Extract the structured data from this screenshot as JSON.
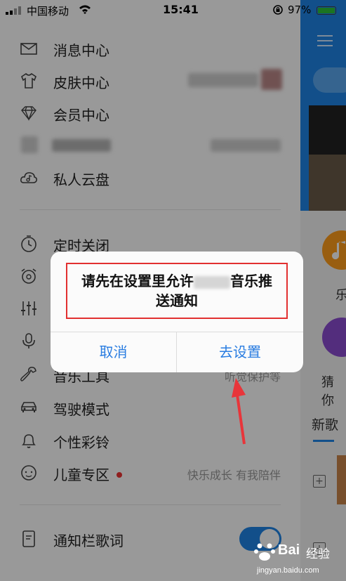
{
  "status_bar": {
    "carrier": "中国移动",
    "time": "15:41",
    "battery": "97%"
  },
  "drawer": {
    "items": [
      {
        "label": "消息中心",
        "icon": "mail-icon"
      },
      {
        "label": "皮肤中心",
        "icon": "shirt-icon"
      },
      {
        "label": "会员中心",
        "icon": "diamond-icon"
      },
      {
        "label": "",
        "icon": "blurred-icon"
      },
      {
        "label": "私人云盘",
        "icon": "cloud-music-icon"
      },
      {
        "label": "定时关闭",
        "icon": "timer-icon"
      },
      {
        "label": "",
        "icon": "alarm-clock-icon"
      },
      {
        "label": "",
        "icon": "equalizer-icon"
      },
      {
        "label": "",
        "icon": "microphone-icon"
      },
      {
        "label": "音乐工具",
        "icon": "wrench-icon",
        "right": "听觉保护等"
      },
      {
        "label": "驾驶模式",
        "icon": "car-icon"
      },
      {
        "label": "个性彩铃",
        "icon": "bell-icon"
      },
      {
        "label": "儿童专区",
        "icon": "kids-icon",
        "right": "快乐成长 有我陪伴",
        "dot": true
      },
      {
        "label": "通知栏歌词",
        "icon": "notification-lyrics-icon",
        "toggle": true
      }
    ]
  },
  "main_page": {
    "label_le": "乐",
    "label_guess": "猜你",
    "label_new_song": "新歌"
  },
  "dialog": {
    "message_part1": "请先在设置里允许",
    "message_part2": "音乐推",
    "message_line2": "送通知",
    "cancel_label": "取消",
    "settings_label": "去设置"
  },
  "watermark": {
    "brand": "Bai",
    "brand_cn": "经验",
    "url": "jingyan.baidu.com"
  },
  "colors": {
    "accent": "#1f84e6",
    "dialog_button": "#2a7de1",
    "highlight_border": "#e23030",
    "arrow": "#e8353a"
  }
}
